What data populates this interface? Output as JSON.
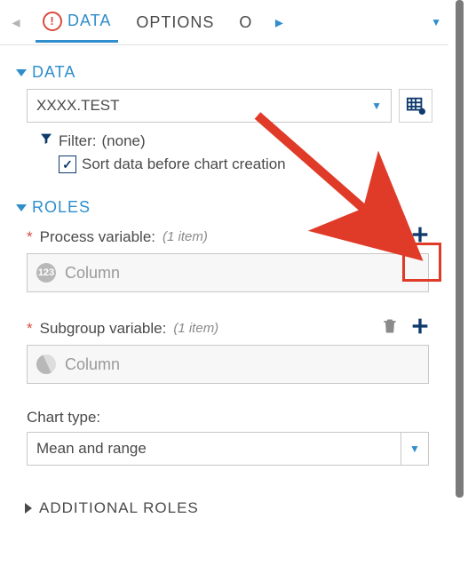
{
  "tabs": {
    "prev": "◂",
    "data_label": "DATA",
    "options_label": "OPTIONS",
    "overflow": "O",
    "next": "▸"
  },
  "data_section": {
    "title": "DATA",
    "table": "XXXX.TEST",
    "filter_label": "Filter:",
    "filter_value": "(none)",
    "sort_label": "Sort data before chart creation",
    "sort_checked": true
  },
  "roles_section": {
    "title": "ROLES",
    "process": {
      "label": "Process variable:",
      "count": "(1 item)",
      "placeholder": "Column"
    },
    "subgroup": {
      "label": "Subgroup variable:",
      "count": "(1 item)",
      "placeholder": "Column"
    },
    "charttype": {
      "label": "Chart type:",
      "value": "Mean and range"
    }
  },
  "additional_roles": {
    "title": "ADDITIONAL ROLES"
  }
}
